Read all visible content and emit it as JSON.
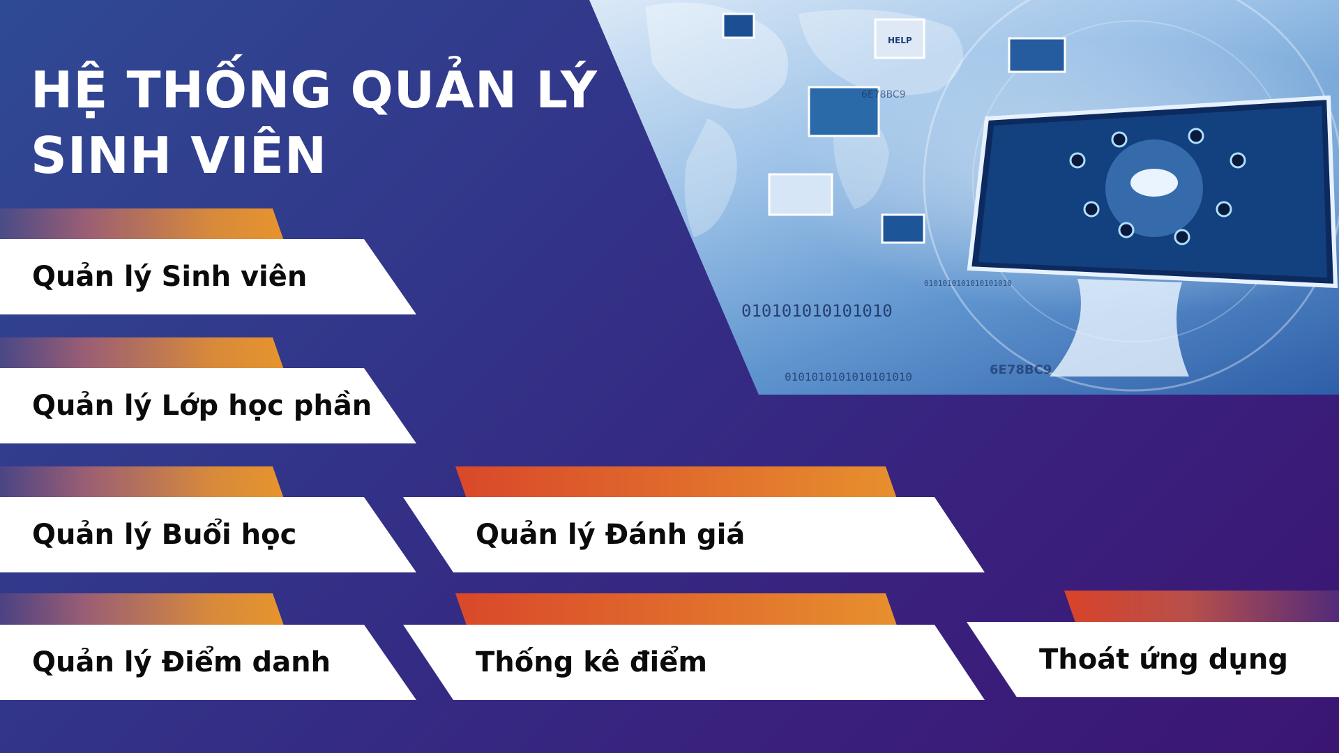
{
  "app": {
    "title_line1": "HỆ THỐNG QUẢN LÝ",
    "title_line2": "SINH VIÊN"
  },
  "menu": {
    "students": "Quản lý Sinh viên",
    "course_sections": "Quản lý Lớp học phần",
    "sessions": "Quản lý Buổi học",
    "attendance": "Quản lý Điểm danh",
    "evaluation": "Quản lý Đánh giá",
    "grade_stats": "Thống kê điểm",
    "exit": "Thoát ứng dụng"
  },
  "hero": {
    "binary_1": "0101010101010101010",
    "binary_2": "010101010101010",
    "binary_3": "0101010101010101010",
    "hex_1": "6E78BC9",
    "hex_2": "6E78BC9",
    "help_text": "HELP"
  },
  "colors": {
    "accent_orange": "#e7942e",
    "accent_red": "#d9482a",
    "bg_blue": "#2f4a94",
    "bg_purple": "#3a1672"
  }
}
